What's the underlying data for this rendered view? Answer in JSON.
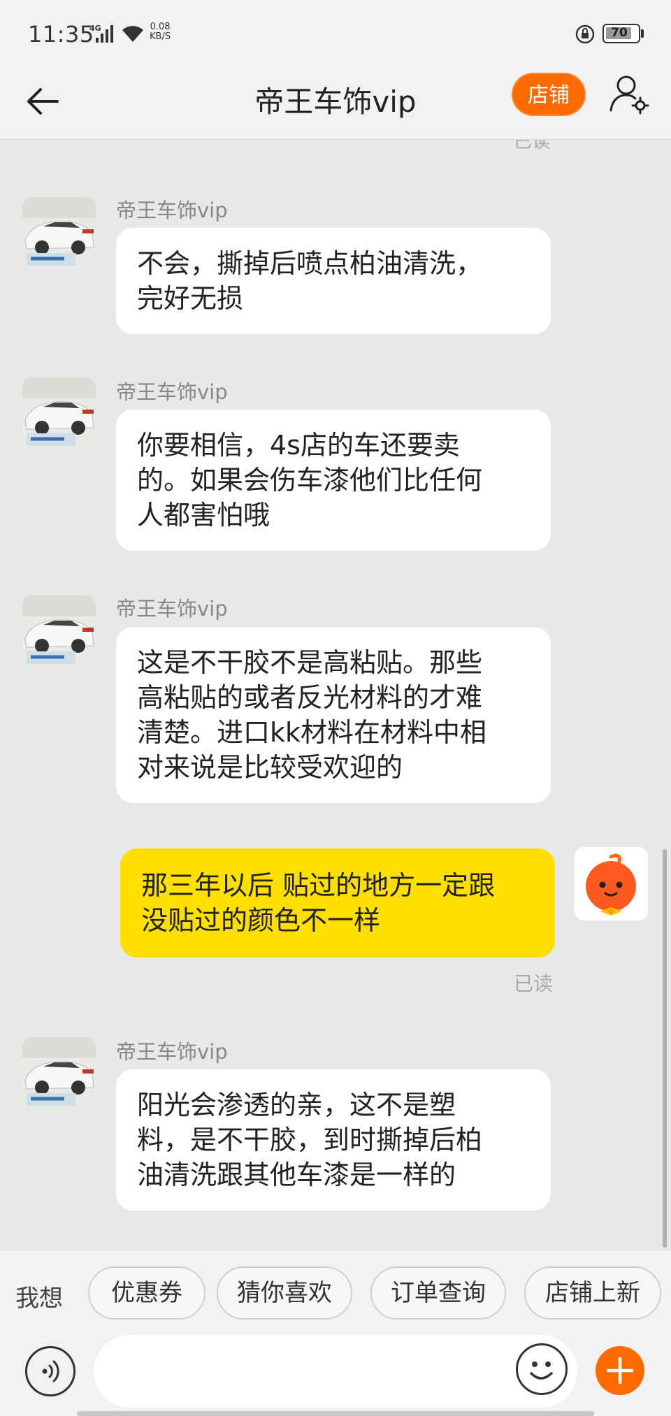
{
  "status_bar": {
    "time": "11:35",
    "network": "4G",
    "speed_value": "0.08",
    "speed_unit": "KB/S",
    "battery": "70"
  },
  "header": {
    "title": "帝王车饰vip",
    "store_label": "店铺",
    "icons": {
      "back": "back-arrow-icon",
      "profile": "user-settings-icon"
    }
  },
  "messages": [
    {
      "from": "shop",
      "sender": "帝王车饰vip",
      "lines": [
        "不会，撕掉后喷点柏油清洗，",
        "完好无损"
      ]
    },
    {
      "from": "shop",
      "sender": "帝王车饰vip",
      "lines": [
        "你要相信，4s店的车还要卖",
        "的。如果会伤车漆他们比任何",
        "人都害怕哦"
      ]
    },
    {
      "from": "shop",
      "sender": "帝王车饰vip",
      "lines": [
        "这是不干胶不是高粘贴。那些",
        "高粘贴的或者反光材料的才难",
        "清楚。进口kk材料在材料中相",
        "对来说是比较受欢迎的"
      ]
    },
    {
      "from": "me",
      "lines": [
        "那三年以后 贴过的地方一定跟",
        "没贴过的颜色不一样"
      ],
      "status": "已读"
    },
    {
      "from": "shop",
      "sender": "帝王车饰vip",
      "lines": [
        "阳光会渗透的亲，这不是塑",
        "料，是不干胶，到时撕掉后柏",
        "油清洗跟其他车漆是一样的"
      ]
    }
  ],
  "read_status_top": "已读",
  "quick_replies": {
    "label": "我想",
    "items": [
      "优惠券",
      "猜你喜欢",
      "订单查询",
      "店铺上新"
    ]
  },
  "input": {
    "placeholder": "",
    "icons": {
      "voice": "voice-icon",
      "emoji": "emoji-icon",
      "more": "plus-icon"
    }
  },
  "colors": {
    "accent": "#ff6a00",
    "my_bubble": "#ffdf00",
    "background": "#e8e8e8"
  }
}
